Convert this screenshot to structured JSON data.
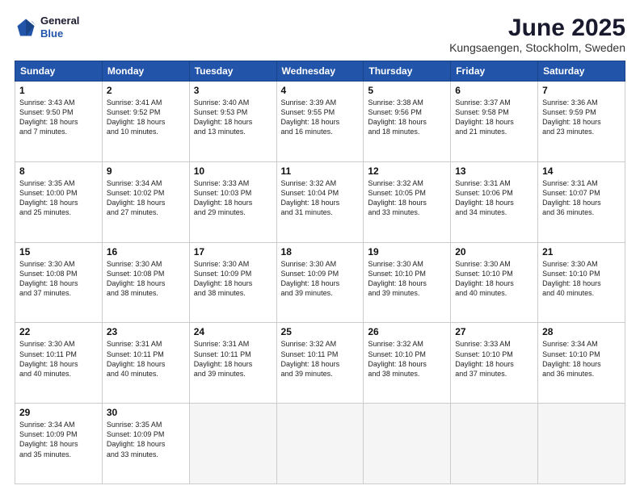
{
  "header": {
    "logo_line1": "General",
    "logo_line2": "Blue",
    "month": "June 2025",
    "location": "Kungsaengen, Stockholm, Sweden"
  },
  "weekdays": [
    "Sunday",
    "Monday",
    "Tuesday",
    "Wednesday",
    "Thursday",
    "Friday",
    "Saturday"
  ],
  "weeks": [
    [
      {
        "day": "1",
        "lines": [
          "Sunrise: 3:43 AM",
          "Sunset: 9:50 PM",
          "Daylight: 18 hours",
          "and 7 minutes."
        ]
      },
      {
        "day": "2",
        "lines": [
          "Sunrise: 3:41 AM",
          "Sunset: 9:52 PM",
          "Daylight: 18 hours",
          "and 10 minutes."
        ]
      },
      {
        "day": "3",
        "lines": [
          "Sunrise: 3:40 AM",
          "Sunset: 9:53 PM",
          "Daylight: 18 hours",
          "and 13 minutes."
        ]
      },
      {
        "day": "4",
        "lines": [
          "Sunrise: 3:39 AM",
          "Sunset: 9:55 PM",
          "Daylight: 18 hours",
          "and 16 minutes."
        ]
      },
      {
        "day": "5",
        "lines": [
          "Sunrise: 3:38 AM",
          "Sunset: 9:56 PM",
          "Daylight: 18 hours",
          "and 18 minutes."
        ]
      },
      {
        "day": "6",
        "lines": [
          "Sunrise: 3:37 AM",
          "Sunset: 9:58 PM",
          "Daylight: 18 hours",
          "and 21 minutes."
        ]
      },
      {
        "day": "7",
        "lines": [
          "Sunrise: 3:36 AM",
          "Sunset: 9:59 PM",
          "Daylight: 18 hours",
          "and 23 minutes."
        ]
      }
    ],
    [
      {
        "day": "8",
        "lines": [
          "Sunrise: 3:35 AM",
          "Sunset: 10:00 PM",
          "Daylight: 18 hours",
          "and 25 minutes."
        ]
      },
      {
        "day": "9",
        "lines": [
          "Sunrise: 3:34 AM",
          "Sunset: 10:02 PM",
          "Daylight: 18 hours",
          "and 27 minutes."
        ]
      },
      {
        "day": "10",
        "lines": [
          "Sunrise: 3:33 AM",
          "Sunset: 10:03 PM",
          "Daylight: 18 hours",
          "and 29 minutes."
        ]
      },
      {
        "day": "11",
        "lines": [
          "Sunrise: 3:32 AM",
          "Sunset: 10:04 PM",
          "Daylight: 18 hours",
          "and 31 minutes."
        ]
      },
      {
        "day": "12",
        "lines": [
          "Sunrise: 3:32 AM",
          "Sunset: 10:05 PM",
          "Daylight: 18 hours",
          "and 33 minutes."
        ]
      },
      {
        "day": "13",
        "lines": [
          "Sunrise: 3:31 AM",
          "Sunset: 10:06 PM",
          "Daylight: 18 hours",
          "and 34 minutes."
        ]
      },
      {
        "day": "14",
        "lines": [
          "Sunrise: 3:31 AM",
          "Sunset: 10:07 PM",
          "Daylight: 18 hours",
          "and 36 minutes."
        ]
      }
    ],
    [
      {
        "day": "15",
        "lines": [
          "Sunrise: 3:30 AM",
          "Sunset: 10:08 PM",
          "Daylight: 18 hours",
          "and 37 minutes."
        ]
      },
      {
        "day": "16",
        "lines": [
          "Sunrise: 3:30 AM",
          "Sunset: 10:08 PM",
          "Daylight: 18 hours",
          "and 38 minutes."
        ]
      },
      {
        "day": "17",
        "lines": [
          "Sunrise: 3:30 AM",
          "Sunset: 10:09 PM",
          "Daylight: 18 hours",
          "and 38 minutes."
        ]
      },
      {
        "day": "18",
        "lines": [
          "Sunrise: 3:30 AM",
          "Sunset: 10:09 PM",
          "Daylight: 18 hours",
          "and 39 minutes."
        ]
      },
      {
        "day": "19",
        "lines": [
          "Sunrise: 3:30 AM",
          "Sunset: 10:10 PM",
          "Daylight: 18 hours",
          "and 39 minutes."
        ]
      },
      {
        "day": "20",
        "lines": [
          "Sunrise: 3:30 AM",
          "Sunset: 10:10 PM",
          "Daylight: 18 hours",
          "and 40 minutes."
        ]
      },
      {
        "day": "21",
        "lines": [
          "Sunrise: 3:30 AM",
          "Sunset: 10:10 PM",
          "Daylight: 18 hours",
          "and 40 minutes."
        ]
      }
    ],
    [
      {
        "day": "22",
        "lines": [
          "Sunrise: 3:30 AM",
          "Sunset: 10:11 PM",
          "Daylight: 18 hours",
          "and 40 minutes."
        ]
      },
      {
        "day": "23",
        "lines": [
          "Sunrise: 3:31 AM",
          "Sunset: 10:11 PM",
          "Daylight: 18 hours",
          "and 40 minutes."
        ]
      },
      {
        "day": "24",
        "lines": [
          "Sunrise: 3:31 AM",
          "Sunset: 10:11 PM",
          "Daylight: 18 hours",
          "and 39 minutes."
        ]
      },
      {
        "day": "25",
        "lines": [
          "Sunrise: 3:32 AM",
          "Sunset: 10:11 PM",
          "Daylight: 18 hours",
          "and 39 minutes."
        ]
      },
      {
        "day": "26",
        "lines": [
          "Sunrise: 3:32 AM",
          "Sunset: 10:10 PM",
          "Daylight: 18 hours",
          "and 38 minutes."
        ]
      },
      {
        "day": "27",
        "lines": [
          "Sunrise: 3:33 AM",
          "Sunset: 10:10 PM",
          "Daylight: 18 hours",
          "and 37 minutes."
        ]
      },
      {
        "day": "28",
        "lines": [
          "Sunrise: 3:34 AM",
          "Sunset: 10:10 PM",
          "Daylight: 18 hours",
          "and 36 minutes."
        ]
      }
    ],
    [
      {
        "day": "29",
        "lines": [
          "Sunrise: 3:34 AM",
          "Sunset: 10:09 PM",
          "Daylight: 18 hours",
          "and 35 minutes."
        ]
      },
      {
        "day": "30",
        "lines": [
          "Sunrise: 3:35 AM",
          "Sunset: 10:09 PM",
          "Daylight: 18 hours",
          "and 33 minutes."
        ]
      },
      {
        "day": "",
        "lines": []
      },
      {
        "day": "",
        "lines": []
      },
      {
        "day": "",
        "lines": []
      },
      {
        "day": "",
        "lines": []
      },
      {
        "day": "",
        "lines": []
      }
    ]
  ]
}
